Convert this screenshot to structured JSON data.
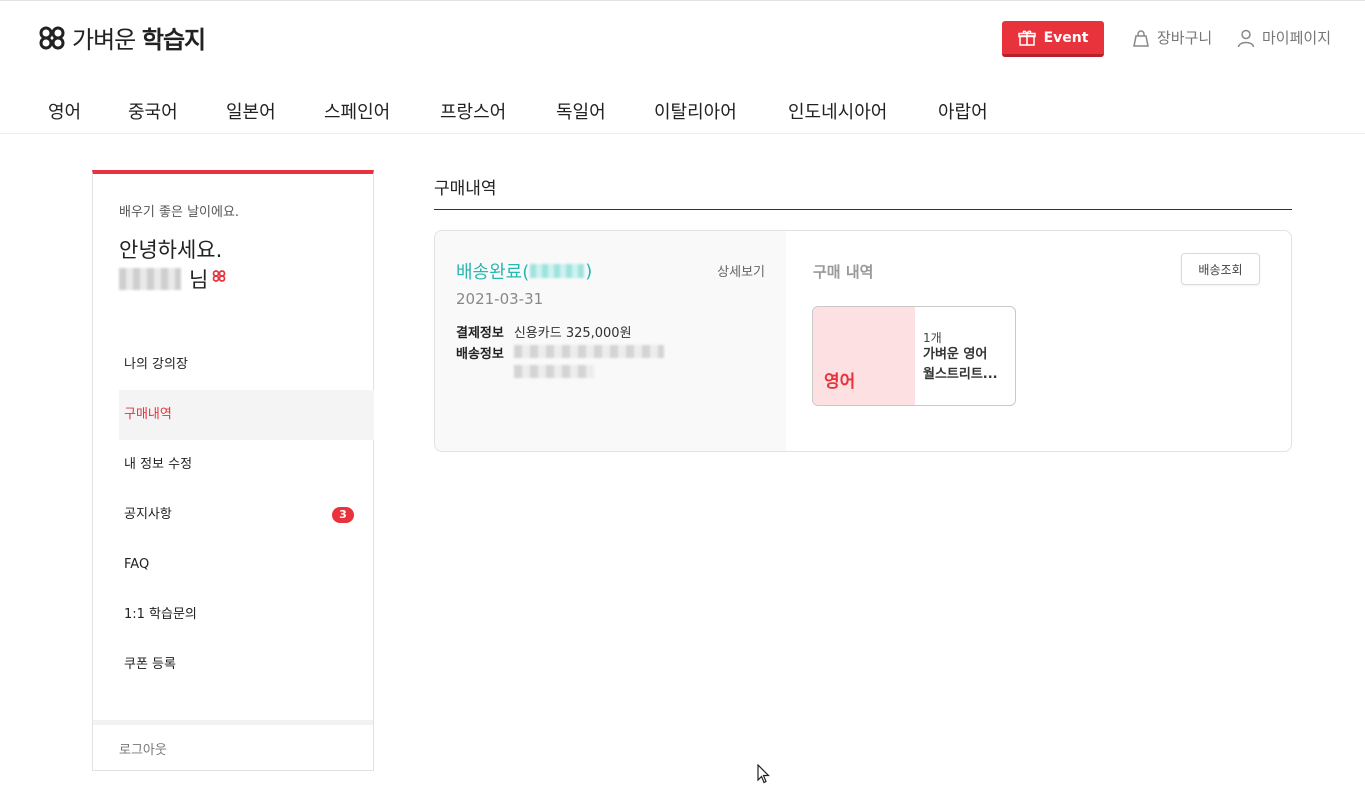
{
  "header": {
    "logo_prefix": "가벼운",
    "logo_bold": "학습지",
    "event_label": "Event",
    "cart_label": "장바구니",
    "mypage_label": "마이페이지",
    "brand_color": "#e8323c"
  },
  "nav": {
    "items": [
      "영어",
      "중국어",
      "일본어",
      "스페인어",
      "프랑스어",
      "독일어",
      "이탈리아어",
      "인도네시아어",
      "아랍어"
    ]
  },
  "sidebar": {
    "greeting_small": "배우기 좋은 날이에요.",
    "greeting_big": "안녕하세요.",
    "honorific": "님",
    "menu": [
      {
        "label": "나의 강의장"
      },
      {
        "label": "구매내역",
        "active": true
      },
      {
        "label": "내 정보 수정"
      },
      {
        "label": "공지사항",
        "badge": "3"
      },
      {
        "label": "FAQ"
      },
      {
        "label": "1:1 학습문의"
      },
      {
        "label": "쿠폰 등록"
      }
    ],
    "logout": "로그아웃"
  },
  "main": {
    "title": "구매내역",
    "order": {
      "status_prefix": "배송완료(",
      "status_suffix": ")",
      "detail_link": "상세보기",
      "date": "2021-03-31",
      "payment_label": "결제정보",
      "payment_value": "신용카드 325,000원",
      "shipping_label": "배송정보",
      "status_color": "#27b8b0"
    },
    "history": {
      "title": "구매 내역",
      "ship_button": "배송조회",
      "product": {
        "thumb_label": "영어",
        "qty": "1개",
        "name_line1": "가벼운 영어",
        "name_line2": "월스트리트..."
      }
    }
  }
}
